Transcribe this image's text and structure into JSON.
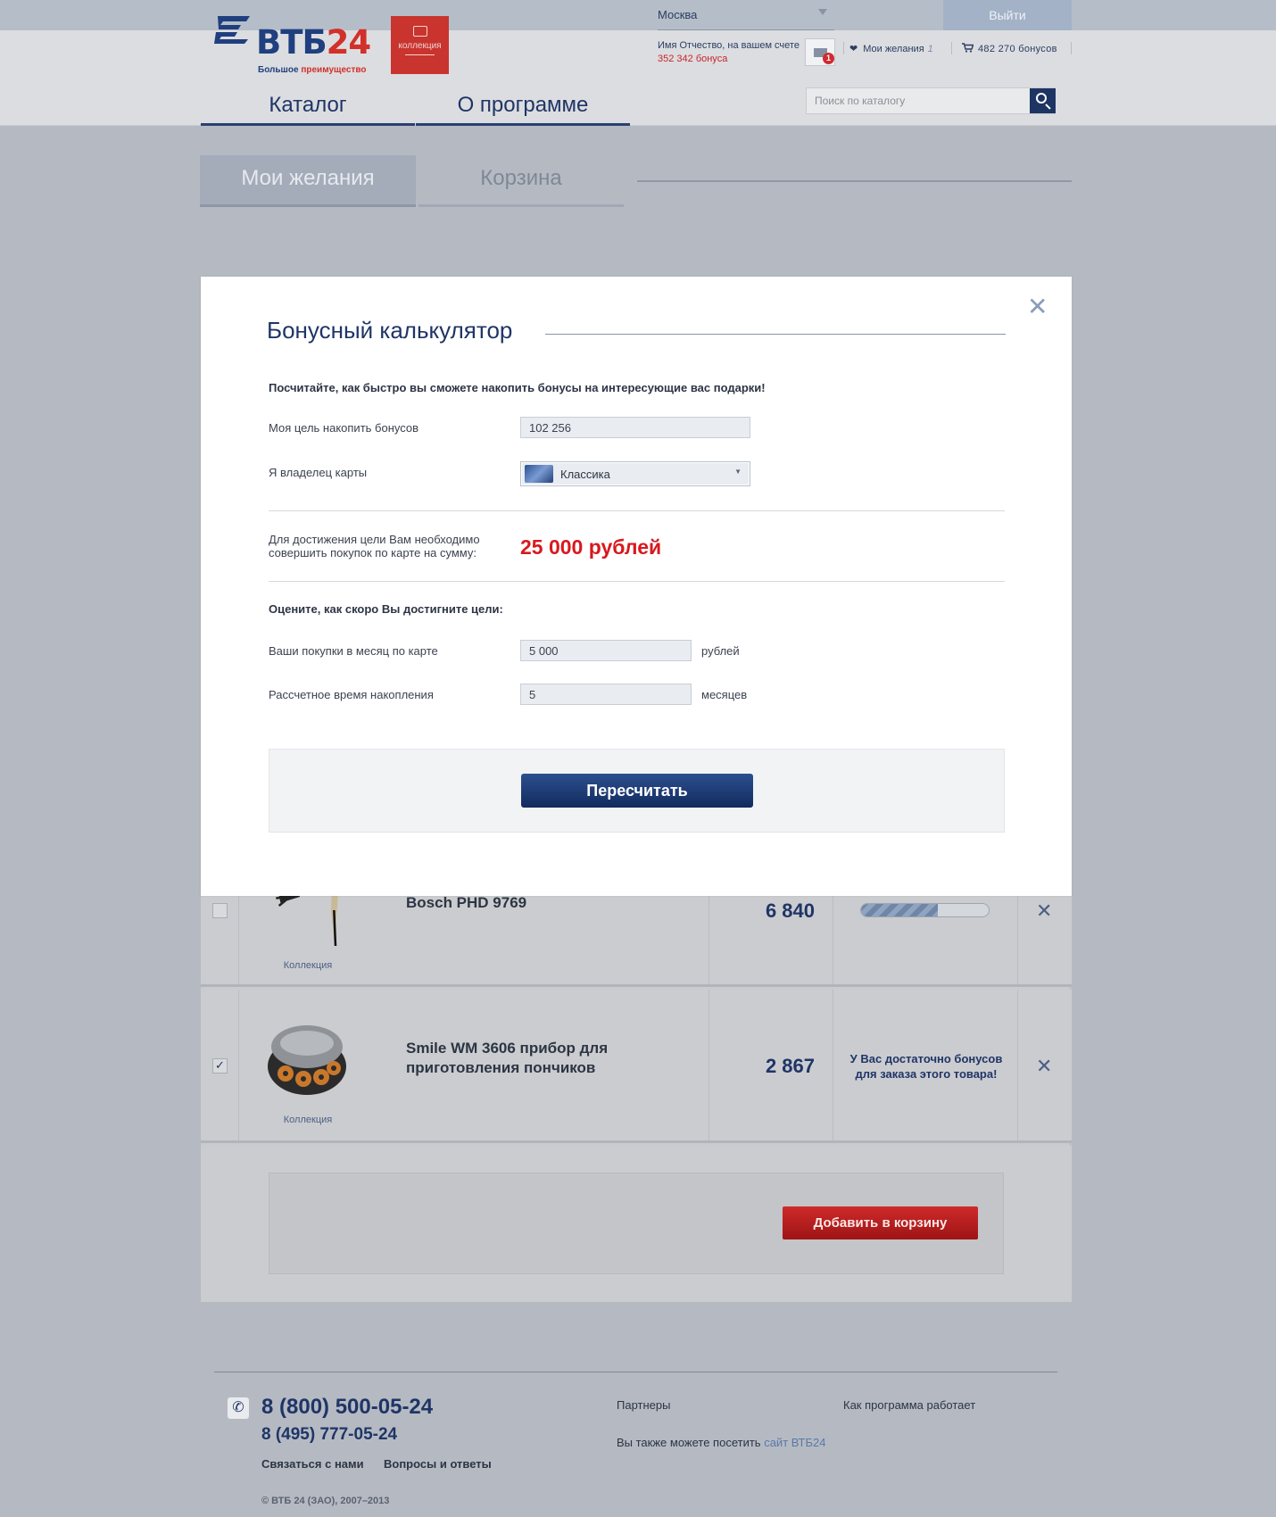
{
  "header": {
    "brand": "ВТБ24",
    "brand_prefix": "ВТБ",
    "brand_suffix": "24",
    "slogan_main": "Большое",
    "slogan_accent": "преимущество",
    "collection_badge": "коллекция",
    "city": "Москва",
    "logout": "Выйти",
    "account_text": "Имя Отчество, на вашем счете",
    "account_bonus": "352 342 бонуса",
    "messages_count": "1",
    "wishes_label": "Мои желания",
    "wishes_count": "1",
    "bonuses_label": "482 270 бонусов",
    "nav": [
      "Каталог",
      "О программе"
    ],
    "search_placeholder": "Поиск по каталогу"
  },
  "tabs": {
    "wishes": "Мои желания",
    "cart": "Корзина"
  },
  "products": [
    {
      "title": "Bosch PHD 9769",
      "collection": "Коллекция",
      "price": "6 840",
      "checked": false,
      "progress": 0.6
    },
    {
      "title": "Smile WM 3606 прибор для приготовления пончиков",
      "title_line1": "Smile WM 3606 прибор для",
      "title_line2": "приготовления пончиков",
      "collection": "Коллекция",
      "price": "2 867",
      "checked": true,
      "status": "У Вас достаточно бонусов для заказа этого товара!",
      "status_line1": "У Вас достаточно бонусов",
      "status_line2": "для заказа этого товара!"
    }
  ],
  "add_to_cart": "Добавить в корзину",
  "footer": {
    "phone1": "8 (800) 500-05-24",
    "phone2": "8 (495) 777-05-24",
    "contact": "Связаться с нами",
    "faq": "Вопросы и ответы",
    "partners": "Партнеры",
    "how_it_works": "Как программа работает",
    "visit_text": "Вы также можете посетить",
    "visit_link": "сайт ВТБ24",
    "copyright": "© ВТБ 24 (ЗАО), 2007–2013"
  },
  "calculator": {
    "title": "Бонусный калькулятор",
    "intro": "Посчитайте, как быстро вы сможете накопить бонусы на интересующие вас подарки!",
    "goal_label": "Моя цель накопить бонусов",
    "goal_value": "102 256",
    "card_label": "Я владелец карты",
    "card_value": "Классика",
    "need_text_line1": "Для достижения цели Вам необходимо",
    "need_text_line2": "совершить покупок по карте на сумму:",
    "need_sum": "25 000 рублей",
    "rate_heading": "Оцените, как скоро Вы достигните цели:",
    "monthly_label": "Ваши покупки в месяц по карте",
    "monthly_value": "5 000",
    "monthly_unit": "рублей",
    "time_label": "Рассчетное время накопления",
    "time_value": "5",
    "time_unit": "месяцев",
    "recalc": "Пересчитать"
  },
  "colors": {
    "brand_blue": "#1f3567",
    "accent_red": "#d7191f",
    "button_red": "#c01f1f"
  }
}
